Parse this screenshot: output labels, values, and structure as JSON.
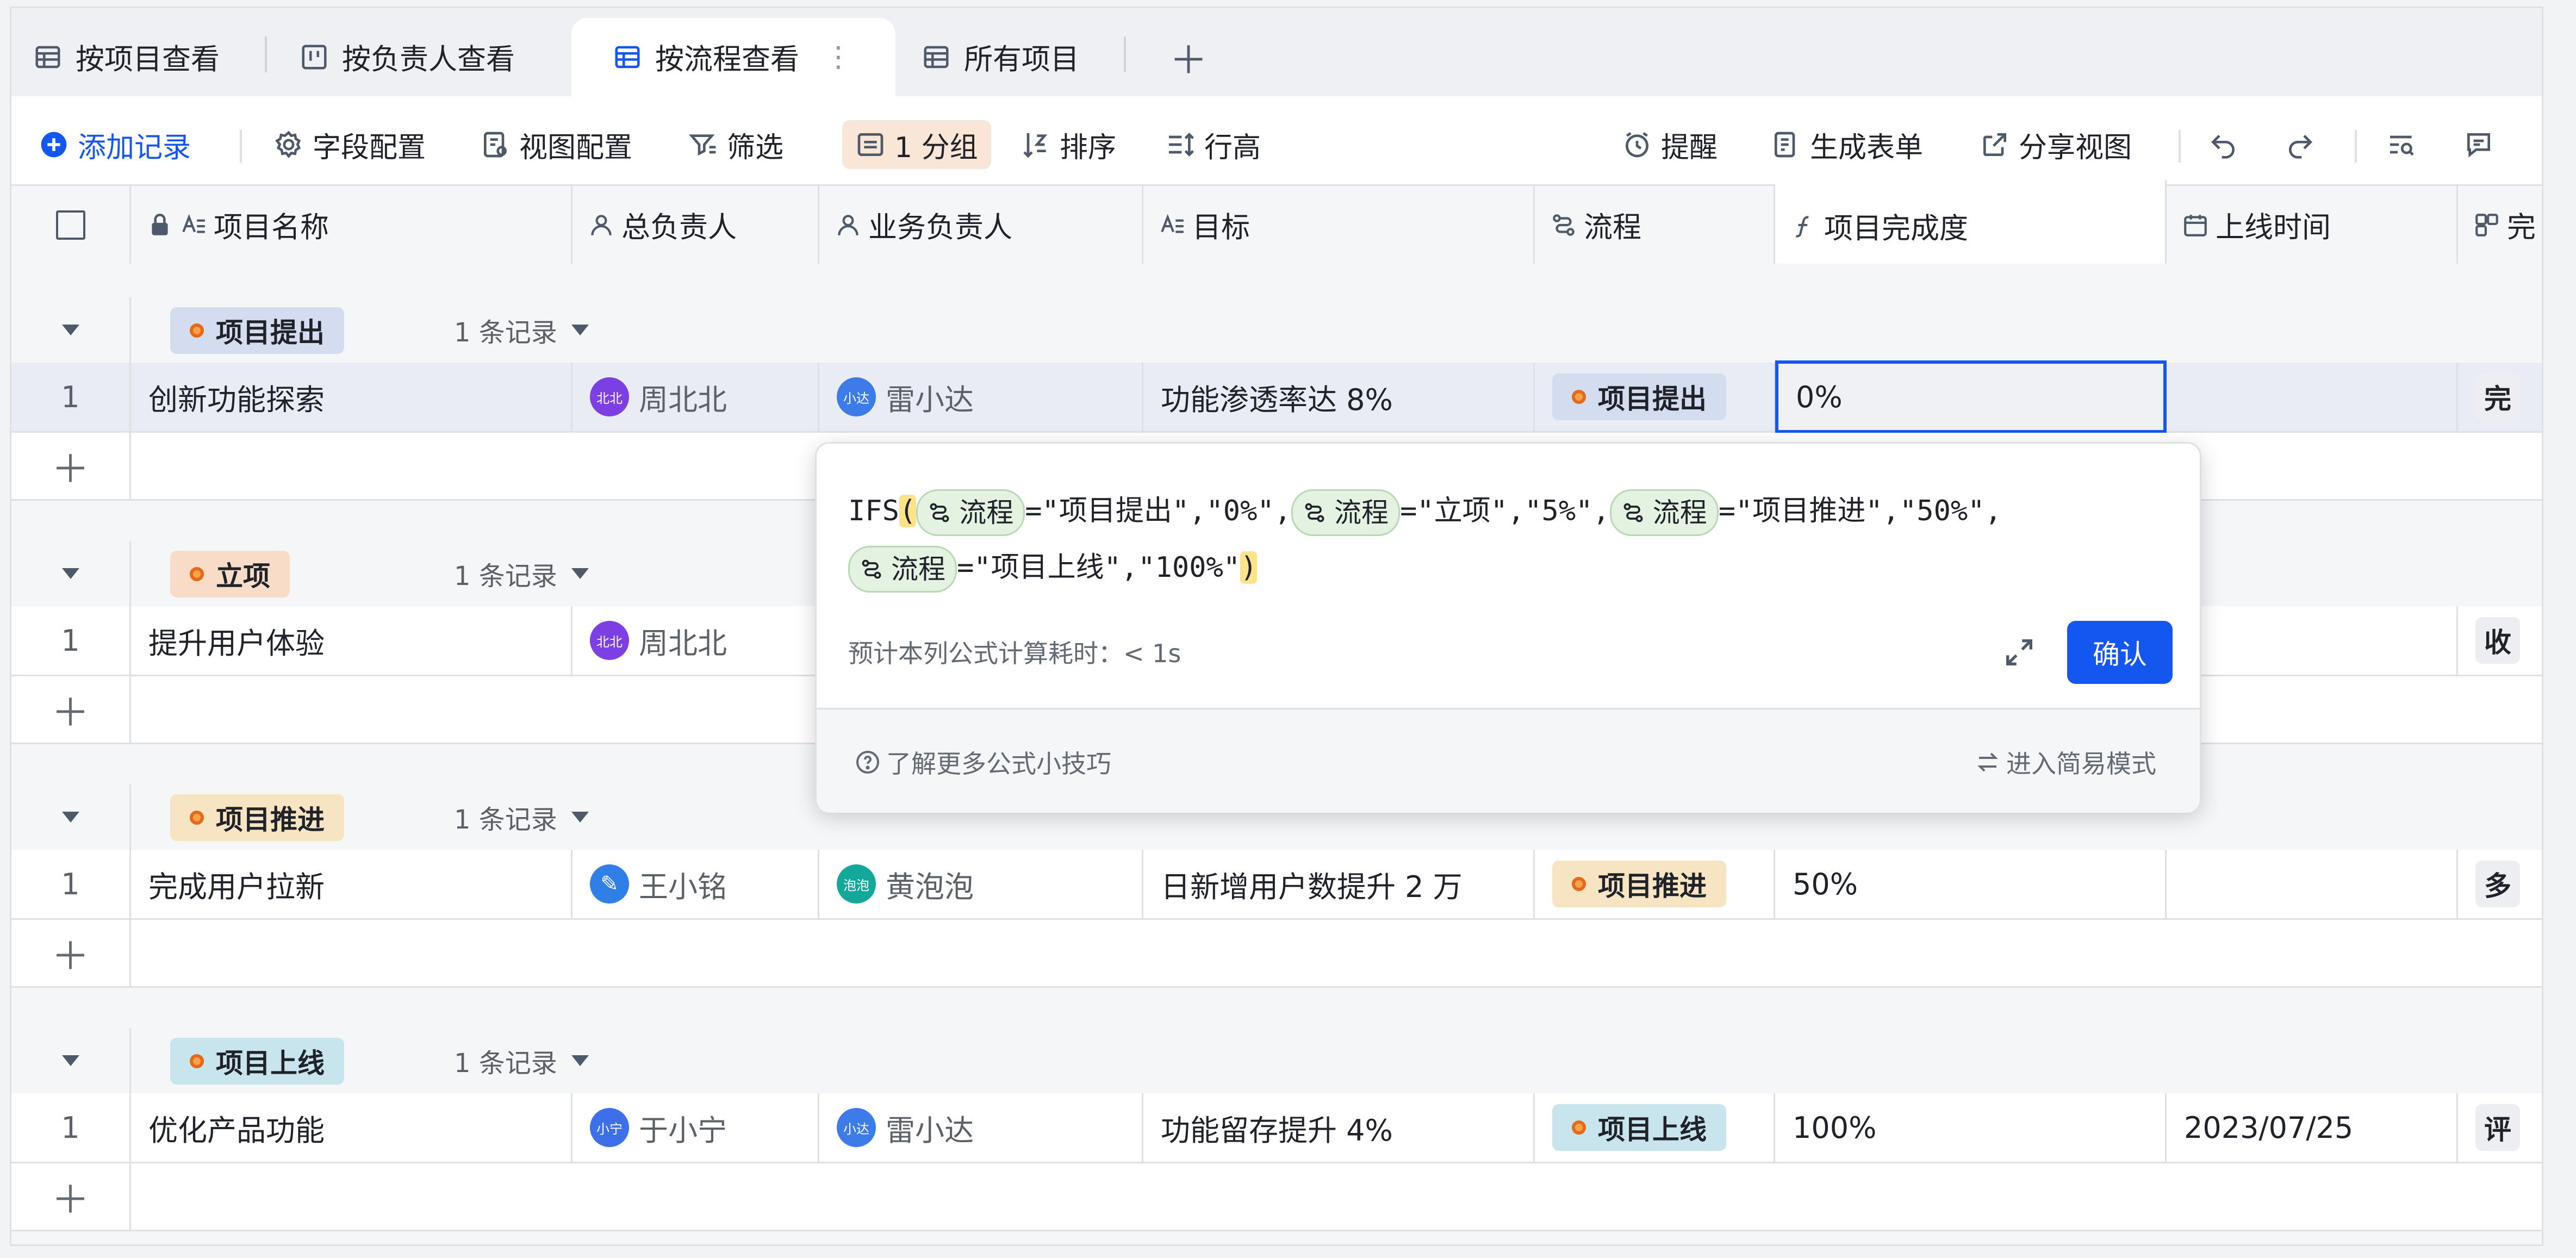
{
  "tabs": [
    {
      "label": "按项目查看"
    },
    {
      "label": "按负责人查看"
    },
    {
      "label": "按流程查看"
    },
    {
      "label": "所有项目"
    }
  ],
  "toolbar": {
    "add_record": "添加记录",
    "field_config": "字段配置",
    "view_config": "视图配置",
    "filter": "筛选",
    "group": "1 分组",
    "sort": "排序",
    "row_height": "行高",
    "remind": "提醒",
    "gen_form": "生成表单",
    "share_view": "分享视图"
  },
  "columns": [
    {
      "label": "项目名称"
    },
    {
      "label": "总负责人"
    },
    {
      "label": "业务负责人"
    },
    {
      "label": "目标"
    },
    {
      "label": "流程"
    },
    {
      "label": "项目完成度"
    },
    {
      "label": "上线时间"
    },
    {
      "label": "完"
    }
  ],
  "groups": [
    {
      "tag": "项目提出",
      "count": "1 条记录",
      "row": {
        "num": "1",
        "name": "创新功能探索",
        "owner": "周北北",
        "owner_avatar": "北北",
        "biz": "雷小达",
        "biz_avatar": "小达",
        "goal": "功能渗透率达 8%",
        "flow": "项目提出",
        "progress": "0%",
        "date": "",
        "extra": "完"
      }
    },
    {
      "tag": "立项",
      "count": "1 条记录",
      "row": {
        "num": "1",
        "name": "提升用户体验",
        "owner": "周北北",
        "owner_avatar": "北北",
        "extra": "收"
      }
    },
    {
      "tag": "项目推进",
      "count": "1 条记录",
      "row": {
        "num": "1",
        "name": "完成用户拉新",
        "owner": "王小铭",
        "owner_avatar": "",
        "biz": "黄泡泡",
        "biz_avatar": "泡泡",
        "goal": "日新增用户数提升 2 万",
        "flow": "项目推进",
        "progress": "50%",
        "date": "",
        "extra": "多"
      }
    },
    {
      "tag": "项目上线",
      "count": "1 条记录",
      "row": {
        "num": "1",
        "name": "优化产品功能",
        "owner": "于小宁",
        "owner_avatar": "小宁",
        "biz": "雷小达",
        "biz_avatar": "小达",
        "goal": "功能留存提升 4%",
        "flow": "项目上线",
        "progress": "100%",
        "date": "2023/07/25",
        "extra": "评"
      }
    }
  ],
  "formula_popup": {
    "fn": "IFS",
    "field": "流程",
    "p1": "=\"项目提出\",\"0%\",",
    "p2": "=\"立项\",\"5%\",",
    "p3": "=\"项目推进\",\"50%\",",
    "p4": "=\"项目上线\",\"100%\"",
    "estimate": "预计本列公式计算耗时：< 1s",
    "confirm": "确认",
    "tips": "了解更多公式小技巧",
    "simple_mode": "进入简易模式"
  },
  "colors": {
    "accent": "#1456f0",
    "tag_proposed": "#d4dcef",
    "tag_approved": "#f8dcc8",
    "tag_progress": "#f6e4c3",
    "tag_launched": "#c8e4ec"
  }
}
